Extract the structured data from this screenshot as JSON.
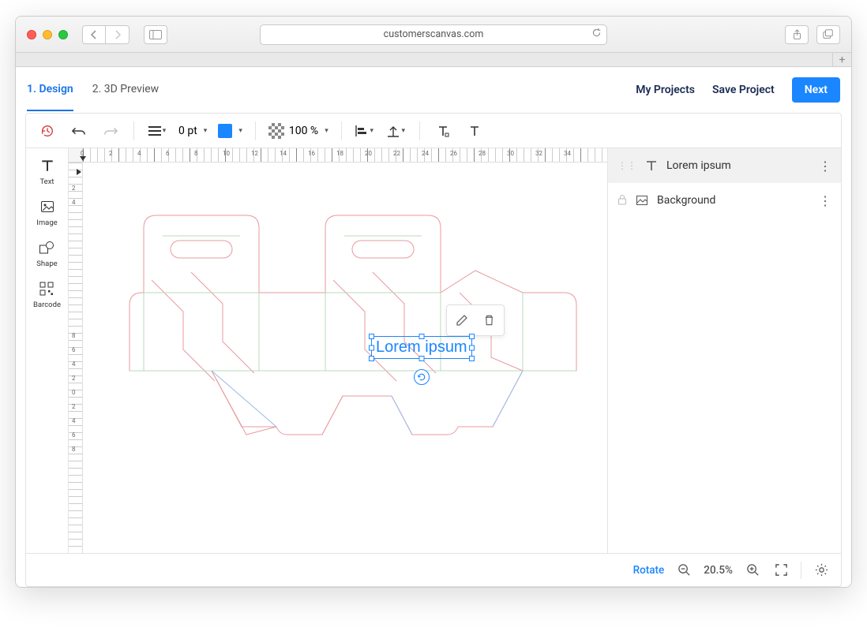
{
  "browser": {
    "url": "customerscanvas.com"
  },
  "header": {
    "tabs": [
      {
        "label": "1. Design",
        "active": true
      },
      {
        "label": "2. 3D Preview",
        "active": false
      }
    ],
    "my_projects": "My Projects",
    "save_project": "Save Project",
    "next": "Next"
  },
  "toolbar": {
    "stroke_width": "0 pt",
    "color": "#1a86ff",
    "opacity": "100 %"
  },
  "left_tools": {
    "text": "Text",
    "image": "Image",
    "shape": "Shape",
    "barcode": "Barcode"
  },
  "canvas": {
    "selected_text": "Lorem ipsum"
  },
  "ruler_h": [
    "0",
    "2",
    "4",
    "6",
    "8",
    "10",
    "12",
    "14",
    "16",
    "18",
    "20",
    "22",
    "24",
    "26",
    "28",
    "30",
    "32",
    "34"
  ],
  "ruler_v_top": [
    "2",
    "4"
  ],
  "ruler_v_bottom": [
    "8",
    "6",
    "4",
    "2",
    "0",
    "2",
    "4",
    "6",
    "8"
  ],
  "layers": [
    {
      "name": "Lorem ipsum",
      "type": "text",
      "locked": false,
      "selected": true
    },
    {
      "name": "Background",
      "type": "image",
      "locked": true,
      "selected": false
    }
  ],
  "status": {
    "rotate": "Rotate",
    "zoom": "20.5%"
  }
}
